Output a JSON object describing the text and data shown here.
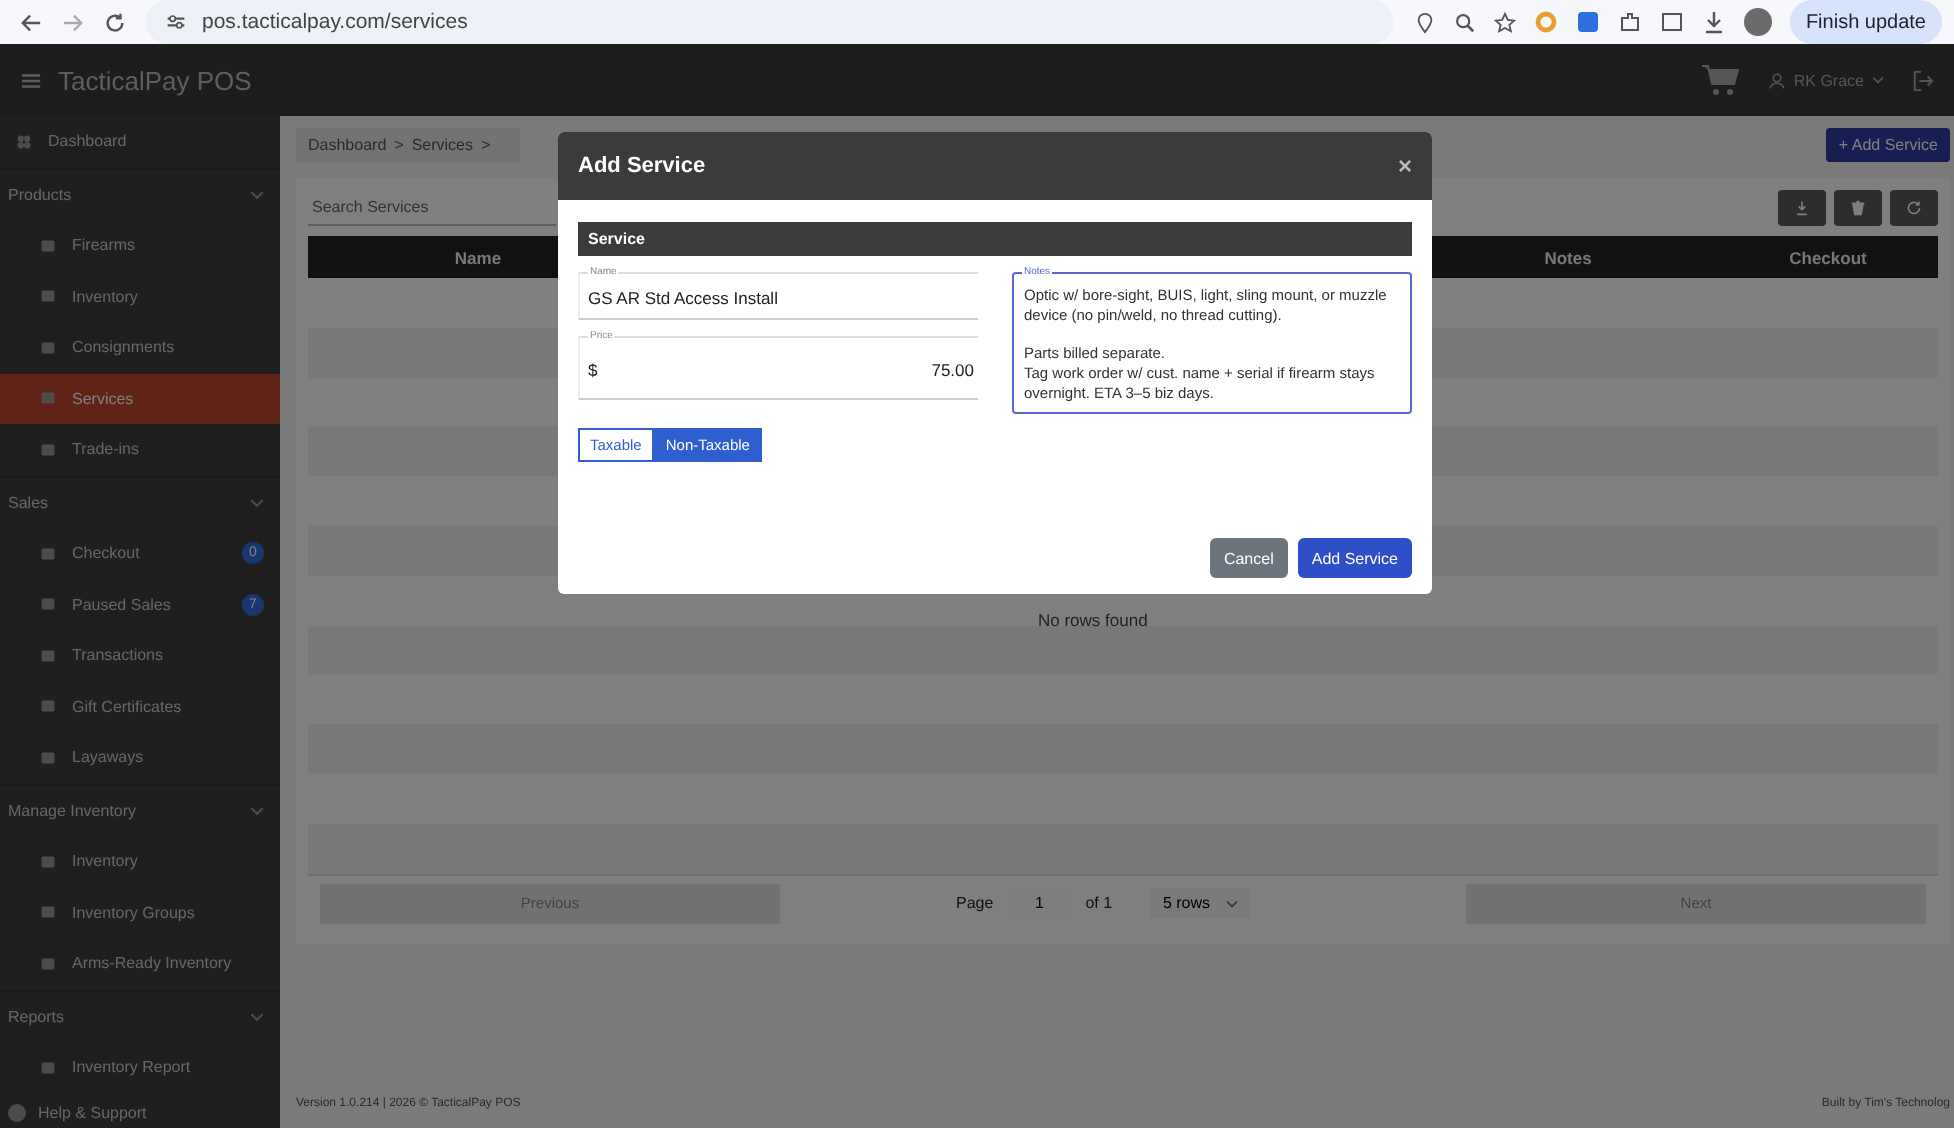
{
  "browser": {
    "url": "pos.tacticalpay.com/services",
    "update_button": "Finish update"
  },
  "header": {
    "title": "TacticalPay POS",
    "user": "RK Grace"
  },
  "sidebar": {
    "items": [
      {
        "kind": "link",
        "label": "Dashboard",
        "selected": false
      },
      {
        "kind": "group",
        "label": "Products",
        "expanded": true,
        "children": [
          {
            "label": "Firearms",
            "selected": false
          },
          {
            "label": "Inventory",
            "selected": false
          },
          {
            "label": "Consignments",
            "selected": false
          },
          {
            "label": "Services",
            "selected": true
          },
          {
            "label": "Trade-ins",
            "selected": false
          }
        ]
      },
      {
        "kind": "group",
        "label": "Sales",
        "expanded": true,
        "children": [
          {
            "label": "Checkout",
            "selected": false,
            "badge": "0"
          },
          {
            "label": "Paused Sales",
            "selected": false,
            "badge": "7"
          },
          {
            "label": "Transactions",
            "selected": false
          },
          {
            "label": "Gift Certificates",
            "selected": false
          },
          {
            "label": "Layaways",
            "selected": false
          }
        ]
      },
      {
        "kind": "group",
        "label": "Manage Inventory",
        "expanded": true,
        "children": [
          {
            "label": "Inventory",
            "selected": false
          },
          {
            "label": "Inventory Groups",
            "selected": false
          },
          {
            "label": "Arms-Ready Inventory",
            "selected": false
          }
        ]
      },
      {
        "kind": "group",
        "label": "Reports",
        "expanded": true,
        "children": [
          {
            "label": "Inventory Report",
            "selected": false
          }
        ]
      }
    ],
    "help": "Help & Support"
  },
  "breadcrumb": [
    "Dashboard",
    ">",
    "Services",
    ">"
  ],
  "add_button": "+ Add Service",
  "search": {
    "placeholder": "Search Services"
  },
  "table": {
    "columns": [
      "Name",
      "Notes",
      "Checkout"
    ],
    "empty_text": "No rows found"
  },
  "pagination": {
    "previous": "Previous",
    "page_label": "Page",
    "page": "1",
    "of": "of 1",
    "rows": "5 rows",
    "next": "Next"
  },
  "footer": {
    "left": "Version 1.0.214 | 2026 © TacticalPay POS",
    "right": "Built by Tim's Technolog"
  },
  "modal": {
    "title": "Add Service",
    "close": "×",
    "section": "Service",
    "fields": [
      {
        "label": "Name",
        "value": "GS AR Std Access Install"
      },
      {
        "label": "Price",
        "prefix": "$",
        "value": "75.00"
      }
    ],
    "notes": {
      "label": "Notes",
      "value": "Optic w/ bore-sight, BUIS, light, sling mount, or muzzle device (no pin/weld, no thread cutting).\n\nParts billed separate.\nTag work order w/ cust. name + serial if firearm stays overnight. ETA 3–5 biz days."
    },
    "tax_options": [
      {
        "label": "Taxable",
        "selected": false
      },
      {
        "label": "Non-Taxable",
        "selected": true
      }
    ],
    "buttons": [
      {
        "kind": "secondary",
        "label": "Cancel"
      },
      {
        "kind": "primary",
        "label": "Add Service"
      }
    ]
  }
}
